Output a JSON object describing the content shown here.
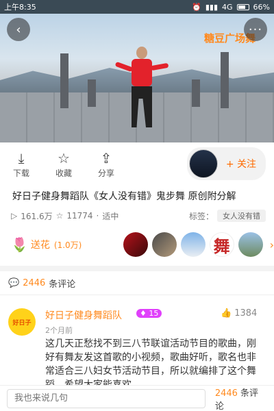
{
  "status_bar": {
    "time": "上午8:35",
    "network": "4G",
    "battery": "66%"
  },
  "video": {
    "watermark": "糖豆广场舞"
  },
  "actions": [
    {
      "label": "下载",
      "icon": "download-icon"
    },
    {
      "label": "收藏",
      "icon": "star-icon"
    },
    {
      "label": "分享",
      "icon": "share-icon"
    }
  ],
  "follow_label": "+ 关注",
  "title": "好日子健身舞蹈队《女人没有错》鬼步舞 原创附分解",
  "meta": {
    "plays": "161.6万",
    "favorites": "11774",
    "level": "适中",
    "tags_label": "标签：",
    "tag": "女人没有错"
  },
  "flowers": {
    "label": "送花",
    "count": "(1.0万)"
  },
  "comments": {
    "count": "2446",
    "suffix": "条评论",
    "items": [
      {
        "avatar_text": "好日子",
        "name": "好日子健身舞蹈队",
        "level": "15",
        "likes": "1384",
        "time": "2个月前",
        "text": "这几天正愁找不到三八节联谊活动节目的歌曲，刚好有舞友发这首歌的小视频，歌曲好听，歌名也非常适合三八妇女节活动节目，所以就编排了这个舞蹈，希望大家能喜欢"
      }
    ]
  },
  "bottom": {
    "placeholder": "我也来说几句",
    "count": "2446",
    "suffix": "条评论"
  },
  "colors": {
    "accent": "#ff8a1f",
    "flower": "#e53935",
    "level_badge": "#e040fb"
  }
}
